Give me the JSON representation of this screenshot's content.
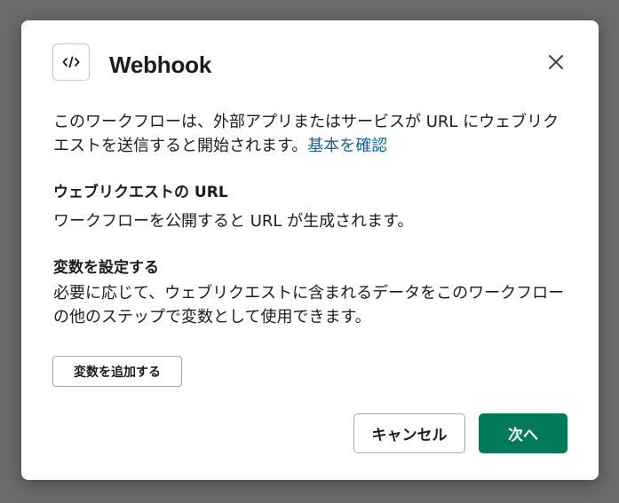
{
  "dialog": {
    "title": "Webhook",
    "icon": "code-brackets-icon",
    "close_icon": "close-icon",
    "intro_text": "このワークフローは、外部アプリまたはサービスが URL にウェブリクエストを送信すると開始されます。",
    "intro_link": "基本を確認",
    "link_color": "#1264a3"
  },
  "webrequest_url_section": {
    "heading": "ウェブリクエストの URL",
    "body": "ワークフローを公開すると URL が生成されます。"
  },
  "variables_section": {
    "heading": "変数を設定する",
    "body": "必要に応じて、ウェブリクエストに含まれるデータをこのワークフローの他のステップで変数として使用できます。",
    "add_button_label": "変数を追加する"
  },
  "footer": {
    "cancel_label": "キャンセル",
    "next_label": "次へ",
    "primary_color": "#007a5a"
  }
}
